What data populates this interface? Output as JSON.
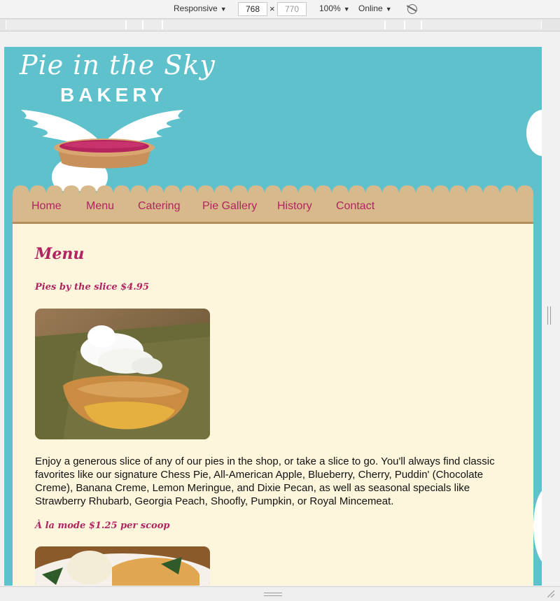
{
  "devtools": {
    "device": "Responsive",
    "width": "768",
    "height": "770",
    "zoom": "100%",
    "network": "Online",
    "times": "×",
    "caret": "▼"
  },
  "site": {
    "logo_line1": "Pie in the Sky",
    "logo_line2": "BAKERY",
    "nav": [
      "Home",
      "Menu",
      "Catering",
      "Pie Gallery",
      "History",
      "Contact"
    ]
  },
  "page": {
    "heading": "Menu",
    "section1_title": "Pies by the slice $4.95",
    "section1_text": "Enjoy a generous slice of any of our pies in the shop, or take a slice to go. You'll always find classic favorites like our signature Chess Pie, All-American Apple, Blueberry, Cherry, Puddin' (Chocolate Creme), Banana Creme, Lemon Meringue, and Dixie Pecan, as well as seasonal specials like Strawberry Rhubarb, Georgia Peach, Shoofly, Pumpkin, or Royal Mincemeat.",
    "section2_title": "À la mode $1.25 per scoop"
  },
  "colors": {
    "sky": "#5fc1cb",
    "nav_bg": "#d8b98b",
    "content_bg": "#fdf6dc",
    "accent": "#b02462"
  },
  "icons": [
    "rotate-icon",
    "wings-icon",
    "pie-icon",
    "cloud-icon"
  ]
}
